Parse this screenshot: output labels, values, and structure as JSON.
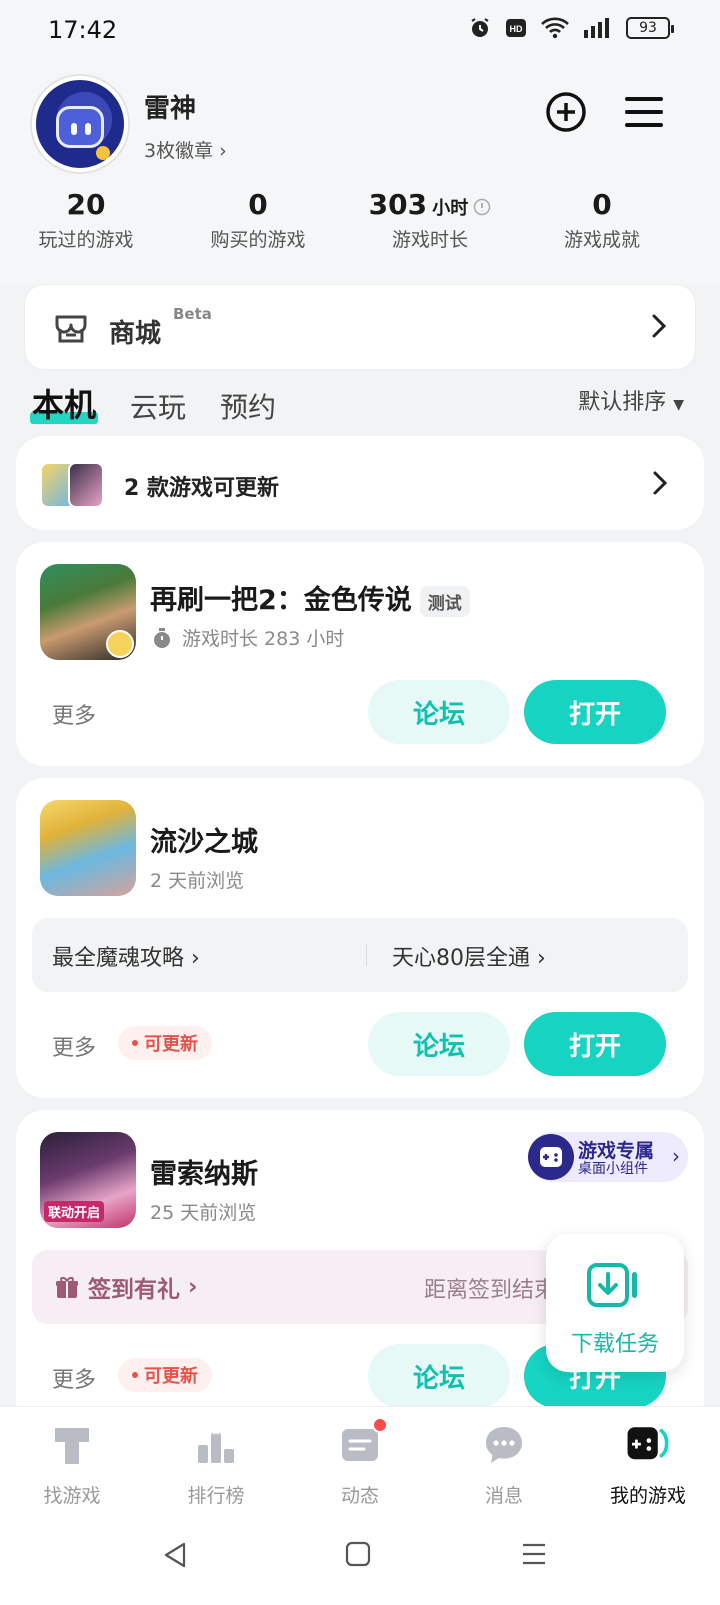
{
  "status_bar": {
    "time": "17:42",
    "battery": "93"
  },
  "profile": {
    "name": "雷神",
    "badges": "3枚徽章"
  },
  "stats": [
    {
      "value": "20",
      "unit": "",
      "label": "玩过的游戏"
    },
    {
      "value": "0",
      "unit": "",
      "label": "购买的游戏"
    },
    {
      "value": "303",
      "unit": "小时",
      "label": "游戏时长"
    },
    {
      "value": "0",
      "unit": "",
      "label": "游戏成就"
    }
  ],
  "mall": {
    "title": "商城",
    "badge": "Beta"
  },
  "tabs": {
    "local": "本机",
    "cloud": "云玩",
    "reserve": "预约",
    "sort": "默认排序"
  },
  "updates": {
    "text": "2 款游戏可更新"
  },
  "games": [
    {
      "title": "再刷一把2：金色传说",
      "tag": "测试",
      "sub": "游戏时长 283 小时",
      "more": "更多",
      "forum": "论坛",
      "open": "打开"
    },
    {
      "title": "流沙之城",
      "sub": "2 天前浏览",
      "guide_left": "最全魔魂攻略",
      "guide_right": "天心80层全通",
      "more": "更多",
      "update": "可更新",
      "forum": "论坛",
      "open": "打开"
    },
    {
      "title": "雷索纳斯",
      "sub": "25 天前浏览",
      "widget_title": "游戏专属",
      "widget_sub": "桌面小组件",
      "sign_left": "签到有礼",
      "sign_right": "距离签到结束",
      "more": "更多",
      "update": "可更新",
      "forum": "论坛",
      "open": "打开",
      "icon_text": "联动开启"
    }
  ],
  "download_task": {
    "label": "下载任务"
  },
  "bottom_nav": [
    {
      "label": "找游戏"
    },
    {
      "label": "排行榜"
    },
    {
      "label": "动态"
    },
    {
      "label": "消息"
    },
    {
      "label": "我的游戏"
    }
  ],
  "colors": {
    "accent": "#16d3c2",
    "update_red": "#e8524c",
    "widget_navy": "#2b2a8c"
  }
}
